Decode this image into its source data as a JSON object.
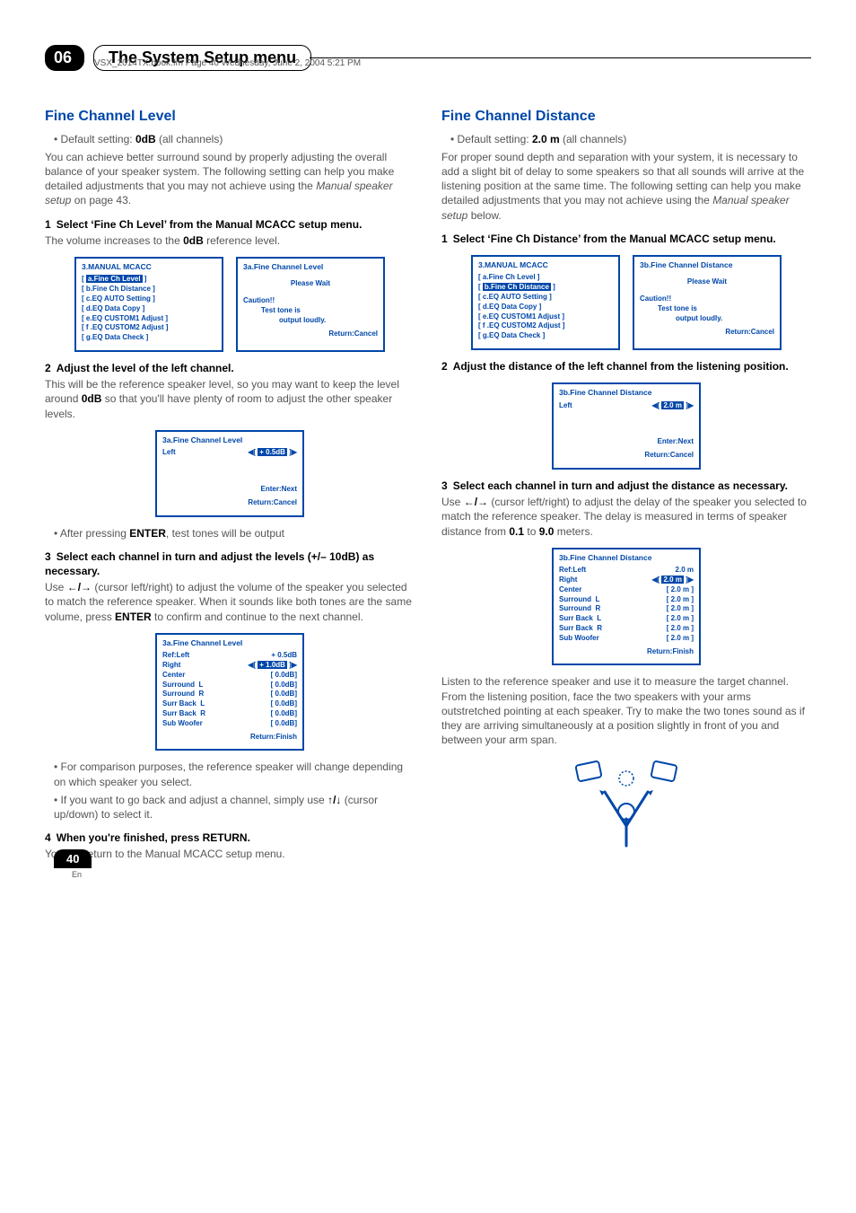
{
  "running_head": "VSX_2014TX.book.fm  Page 40  Wednesday, June 2, 2004  5:21 PM",
  "chapter": {
    "num": "06",
    "title": "The System Setup menu"
  },
  "page_number": "40",
  "page_lang": "En",
  "left": {
    "h2": "Fine Channel Level",
    "default": "Default setting: ",
    "default_val": "0dB",
    "default_suffix": " (all channels)",
    "intro1": "You can achieve better surround sound by properly adjusting the overall balance of your speaker system. The following setting can help you make detailed adjustments that you may not achieve using the ",
    "intro1_italic": "Manual speaker setup",
    "intro1_end": " on page 43.",
    "step1": "Select ‘Fine Ch Level’ from the Manual MCACC setup menu.",
    "step1_text": "The volume increases to the ",
    "step1_bold": "0dB",
    "step1_end": " reference level.",
    "screenA": {
      "title": "3.MANUAL MCACC",
      "items": [
        "a.Fine Ch Level",
        "b.Fine Ch Distance",
        "c.EQ AUTO Setting",
        "d.EQ Data Copy",
        "e.EQ CUSTOM1 Adjust",
        "f .EQ CUSTOM2 Adjust",
        "g.EQ Data Check"
      ]
    },
    "screenB": {
      "title": "3a.Fine Channel Level",
      "wait": "Please Wait",
      "caution": "Caution!!",
      "caution2": "Test tone is",
      "caution3": "output loudly.",
      "ret": "Return:Cancel"
    },
    "step2": "Adjust the level of the left channel.",
    "step2_text1": "This will be the reference speaker level, so you may want to keep the level around ",
    "step2_bold": "0dB",
    "step2_text2": " so that you'll have plenty of room to adjust the other speaker levels.",
    "screenC": {
      "title": "3a.Fine Channel Level",
      "left": "Left",
      "val": "+ 0.5dB",
      "enter": "Enter:Next",
      "ret": "Return:Cancel"
    },
    "after_enter": "After pressing ",
    "after_enter_bold": "ENTER",
    "after_enter_end": ", test tones will be output",
    "step3": "Select each channel in turn and adjust the levels (+/– 10dB) as necessary.",
    "step3_text1": "Use ",
    "step3_glyph": "←/→",
    "step3_text2": " (cursor left/right) to adjust the volume of the speaker you selected to match the reference speaker. When it sounds like both tones are the same volume, press ",
    "step3_bold": "ENTER",
    "step3_text3": " to confirm and continue to the next channel.",
    "screenD": {
      "title": "3a.Fine Channel Level",
      "ref": "Ref:Left",
      "refv": "+ 0.5dB",
      "rows": [
        [
          "Right",
          "",
          "+ 1.0dB"
        ],
        [
          "Center",
          "",
          "0.0dB"
        ],
        [
          "Surround",
          "L",
          "0.0dB"
        ],
        [
          "Surround",
          "R",
          "0.0dB"
        ],
        [
          "Surr Back",
          "L",
          "0.0dB"
        ],
        [
          "Surr Back",
          "R",
          "0.0dB"
        ],
        [
          "Sub Woofer",
          "",
          "0.0dB"
        ]
      ],
      "ret": "Return:Finish"
    },
    "bullet2": "For comparison purposes, the reference speaker will change depending on which speaker you select.",
    "bullet3a": "If you want to go back and adjust a channel, simply use ",
    "bullet3_glyph": "↑/↓",
    "bullet3b": " (cursor up/down) to select it.",
    "step4": "When you're finished, press RETURN.",
    "step4_text": "You will return to the Manual MCACC setup menu."
  },
  "right": {
    "h2": "Fine Channel Distance",
    "default": "Default setting: ",
    "default_val": "2.0 m",
    "default_suffix": " (all channels)",
    "intro": "For proper sound depth and separation with your system, it is necessary to add a slight bit of delay to some speakers so that all sounds will arrive at the listening position at the same time. The following setting can help you make detailed adjustments that you may not achieve using the ",
    "intro_italic": "Manual speaker setup",
    "intro_end": " below.",
    "step1": "Select ‘Fine Ch Distance’ from the Manual MCACC setup menu.",
    "screenA": {
      "title": "3.MANUAL MCACC",
      "items": [
        "a.Fine Ch Level",
        "b.Fine Ch Distance",
        "c.EQ AUTO Setting",
        "d.EQ Data Copy",
        "e.EQ CUSTOM1 Adjust",
        "f .EQ CUSTOM2 Adjust",
        "g.EQ Data Check"
      ]
    },
    "screenB": {
      "title": "3b.Fine Channel Distance",
      "wait": "Please Wait",
      "caution": "Caution!!",
      "caution2": "Test tone is",
      "caution3": "output loudly.",
      "ret": "Return:Cancel"
    },
    "step2": "Adjust the distance of the left channel from the listening position.",
    "screenC": {
      "title": "3b.Fine Channel Distance",
      "left": "Left",
      "val": "2.0 m",
      "enter": "Enter:Next",
      "ret": "Return:Cancel"
    },
    "step3": "Select each channel in turn and adjust the distance as necessary.",
    "step3_text1": "Use ",
    "step3_glyph": "←/→",
    "step3_text2": " (cursor left/right) to adjust the delay of the speaker you selected to match the reference speaker. The delay is measured in terms of speaker distance from ",
    "step3_b1": "0.1",
    "step3_to": " to ",
    "step3_b2": "9.0",
    "step3_end": " meters.",
    "screenD": {
      "title": "3b.Fine Channel Distance",
      "ref": "Ref:Left",
      "refv": "2.0 m",
      "rows": [
        [
          "Right",
          "",
          "2.0 m"
        ],
        [
          "Center",
          "",
          "2.0 m"
        ],
        [
          "Surround",
          "L",
          "2.0 m"
        ],
        [
          "Surround",
          "R",
          "2.0 m"
        ],
        [
          "Surr Back",
          "L",
          "2.0 m"
        ],
        [
          "Surr Back",
          "R",
          "2.0 m"
        ],
        [
          "Sub Woofer",
          "",
          "2.0 m"
        ]
      ],
      "ret": "Return:Finish"
    },
    "listen": "Listen to the reference speaker and use it to measure the target channel. From the listening position, face the two speakers with your arms outstretched pointing at each speaker. Try to make the two tones sound as if they are arriving simultaneously at a position slightly in front of you and between your arm span."
  }
}
